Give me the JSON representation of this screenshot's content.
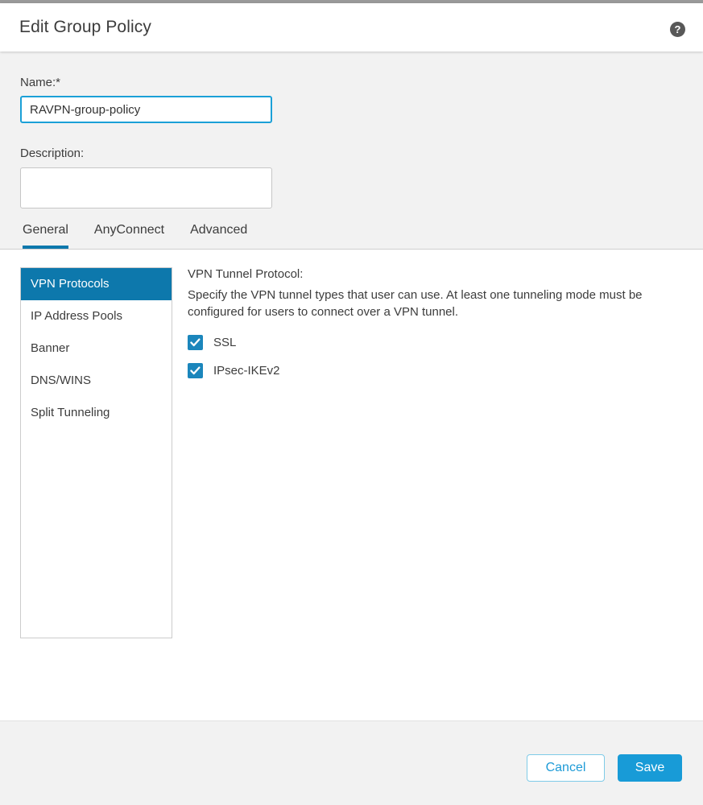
{
  "window": {
    "title": "Edit Group Policy",
    "help_icon": "help-circle-icon",
    "help_glyph": "?"
  },
  "form": {
    "name": {
      "label": "Name:*",
      "value": "RAVPN-group-policy",
      "placeholder": ""
    },
    "description": {
      "label": "Description:",
      "value": "",
      "placeholder": ""
    }
  },
  "tabs": [
    {
      "label": "General",
      "active": true
    },
    {
      "label": "AnyConnect",
      "active": false
    },
    {
      "label": "Advanced",
      "active": false
    }
  ],
  "sidebar": {
    "items": [
      {
        "label": "VPN Protocols",
        "active": true
      },
      {
        "label": "IP Address Pools",
        "active": false
      },
      {
        "label": "Banner",
        "active": false
      },
      {
        "label": "DNS/WINS",
        "active": false
      },
      {
        "label": "Split Tunneling",
        "active": false
      }
    ]
  },
  "detail": {
    "heading": "VPN Tunnel Protocol:",
    "description": "Specify the VPN tunnel types that user can use. At least one tunneling mode must be configured for users to connect over a VPN tunnel.",
    "checkboxes": [
      {
        "label": "SSL",
        "checked": true
      },
      {
        "label": "IPsec-IKEv2",
        "checked": true
      }
    ]
  },
  "footer": {
    "cancel_label": "Cancel",
    "save_label": "Save"
  },
  "colors": {
    "accent_blue": "#0d78ac",
    "control_blue": "#189bd7",
    "checkbox_blue": "#1b86bc",
    "focus_border": "#1ba0d7",
    "panel_gray": "#f2f2f2",
    "text": "#3c3c3c"
  }
}
